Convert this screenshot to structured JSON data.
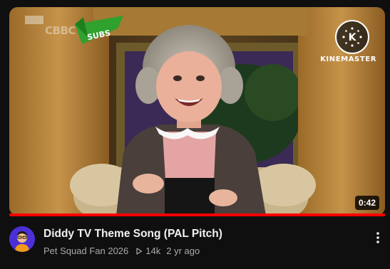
{
  "thumbnail": {
    "watermark_logo": "CBBC",
    "subs_label": "SUBS",
    "editor_watermark": "KINEMASTER",
    "editor_badge_letter": "K",
    "duration": "0:42",
    "watch_progress_fraction": 1.0
  },
  "video": {
    "title": "Diddy TV Theme Song (PAL Pitch)",
    "channel": "Pet Squad Fan 2026",
    "views": "14k",
    "age": "2 yr ago"
  },
  "icons": {
    "views": "play-outline-icon",
    "more": "vertical-dots-icon"
  },
  "colors": {
    "background": "#0f0f0f",
    "progress": "#ff0000",
    "title_text": "#f1f1f1",
    "meta_text": "#aaaaaa",
    "avatar_bg": "#4c2fd6"
  }
}
